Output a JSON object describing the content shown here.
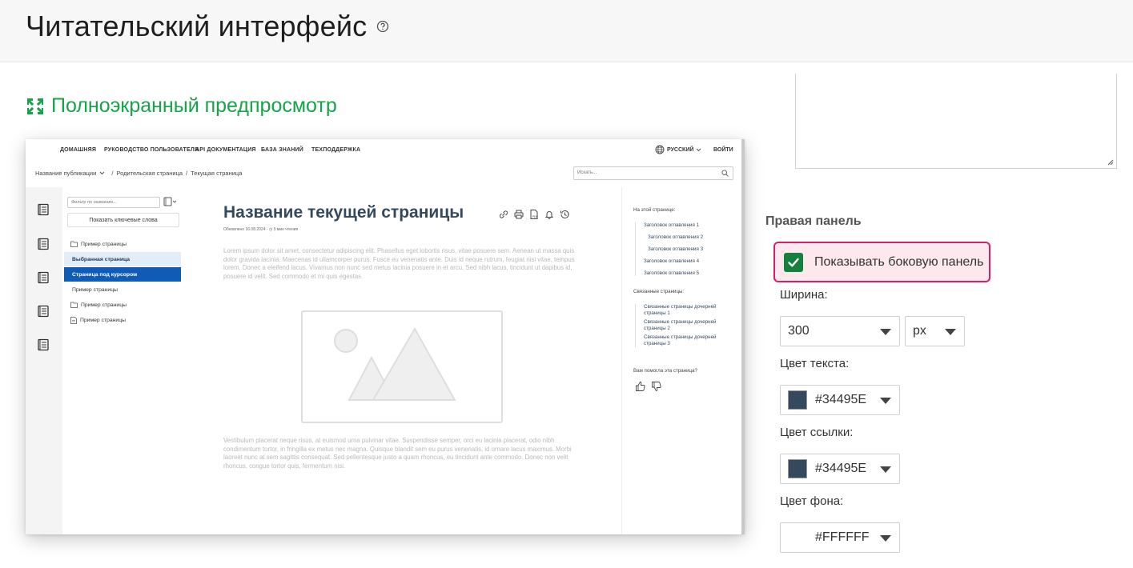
{
  "header": {
    "title": "Читательский интерфейс"
  },
  "fullscreen_link": {
    "label": "Полноэкранный предпросмотр"
  },
  "preview": {
    "nav": [
      "ДОМАШНЯЯ",
      "РУКОВОДСТВО ПОЛЬЗОВАТЕЛЯ",
      "API ДОКУМЕНТАЦИЯ",
      "БАЗА ЗНАНИЙ",
      "ТЕХПОДДЕРЖКА"
    ],
    "language": "РУССКИЙ",
    "login": "ВОЙТИ",
    "breadcrumbs": {
      "publication": "Название публикации",
      "parent": "Родительская страница",
      "current": "Текущая страница"
    },
    "search_placeholder": "Искать...",
    "filter_placeholder": "Фильтр по названию...",
    "show_keywords": "Показать ключевые слова",
    "tree": [
      {
        "label": "Пример страницы",
        "state": "normal"
      },
      {
        "label": "Выбранная страница",
        "state": "selected"
      },
      {
        "label": "Страница под курсором",
        "state": "hover"
      },
      {
        "label": "Пример страницы",
        "state": "normal"
      },
      {
        "label": "Пример страницы",
        "state": "normal"
      },
      {
        "label": "Пример страницы",
        "state": "normal"
      }
    ],
    "page_title": "Название текущей страницы",
    "meta": {
      "updated_label": "Обновлено",
      "updated_date": "16.08.2024",
      "read_time": "5 мин чтения"
    },
    "para1": "Lorem ipsum dolor sit amet, consectetur adipiscing elit. Phasellus eget lobortis risus, vitae posuere sem. Aenean ut massa quis dolor gravida lacinia. Maecenas id ullamcorper purus. Fusce eu venenatis ante. Duis id neque rutrum, feugiat nisi vitae, tempus lorem. Donec a eleifend lacus. Vivamus non nunc sed metus lacinia posuere in et arcu. Sed nibh lacus, tincidunt ut dapibus id, posuere id velit. Sed commodo et mi quis egestas.",
    "para2": "Vestibulum placerat neque risus, at euismod urna pulvinar vitae. Suspendisse semper, orci eu lacinia placerat, odio nibh condimentum tortor, in fringilla ex metus nec magna. Quisque blandit sem eu purus venenatis, id ornare lacus maximus. Morbi laoreet nunc at sem sagittis consequat. Sed pellentesque justo a quam rhoncus, eu tincidunt ante commodo. Donec non velit rhoncus, congue tortor quis, fermentum nisi.",
    "right": {
      "on_this_page": "На этой странице:",
      "toc": [
        "Заголовок оглавления 1",
        "Заголовок оглавления 2",
        "Заголовок оглавления 3",
        "Заголовок оглавления 4",
        "Заголовок оглавления 5"
      ],
      "related_title": "Связанные страницы:",
      "related": [
        "Связанные страницы дочерней страницы 1",
        "Связанные страницы дочерней страницы 2",
        "Связанные страницы дочерней страницы 3"
      ],
      "feedback": "Вам помогла эта страница?"
    }
  },
  "right_panel": {
    "title": "Правая панель",
    "show_sidebar": {
      "label": "Показывать боковую панель",
      "checked": true
    },
    "width_label": "Ширина:",
    "width_value": "300",
    "width_unit": "px",
    "text_color_label": "Цвет текста:",
    "text_color": "#34495E",
    "link_color_label": "Цвет ссылки:",
    "link_color": "#34495E",
    "bg_color_label": "Цвет фона:",
    "bg_color": "#FFFFFF"
  },
  "colors": {
    "accent_green": "#16a34a",
    "check_green": "#15803d",
    "highlight_border": "#d61f69",
    "highlight_bg": "#fde8ee",
    "selected_bg": "#0f5bb5"
  }
}
